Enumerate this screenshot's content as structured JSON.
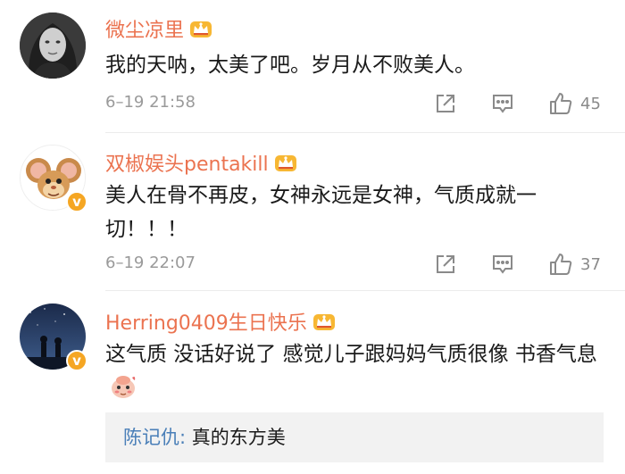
{
  "comments": [
    {
      "user": "微尘凉里",
      "text": "我的天呐，太美了吧。岁月从不败美人。",
      "time": "6–19 21:58",
      "likes": "45"
    },
    {
      "user": "双椒娱头pentakill",
      "text": "美人在骨不再皮，女神永远是女神，气质成就一切！！！",
      "time": "6–19 22:07",
      "likes": "37"
    },
    {
      "user": "Herring0409生日快乐",
      "text": "这气质 没话好说了 感觉儿子跟妈妈气质很像 书香气息",
      "reply": {
        "user": "陈记仇:",
        "text": " 真的东方美"
      }
    }
  ],
  "colors": {
    "username": "#eb7350",
    "reply_user": "#4a7fb8",
    "meta": "#9a9a9a",
    "verified": "#f5a623"
  },
  "icons": [
    "crown-badge-icon",
    "verified-badge-icon",
    "share-icon",
    "comment-icon",
    "like-icon",
    "emoji-icon"
  ]
}
